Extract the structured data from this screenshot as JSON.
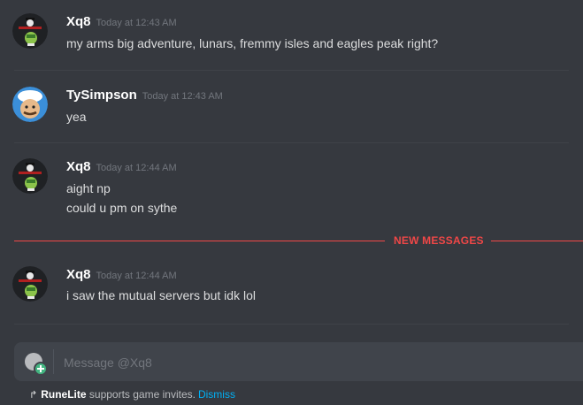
{
  "messages": [
    {
      "author": "Xq8",
      "time": "Today at 12:43 AM",
      "avatar": "pirate-skull-avatar",
      "lines": [
        "my arms big adventure, lunars, fremmy isles and eagles peak right?"
      ]
    },
    {
      "author": "TySimpson",
      "time": "Today at 12:43 AM",
      "avatar": "cartoon-chef-avatar",
      "lines": [
        "yea"
      ]
    },
    {
      "author": "Xq8",
      "time": "Today at 12:44 AM",
      "avatar": "pirate-skull-avatar",
      "lines": [
        "aight np",
        "could u pm on sythe"
      ]
    },
    {
      "author": "Xq8",
      "time": "Today at 12:44 AM",
      "avatar": "pirate-skull-avatar",
      "lines": [
        "i saw the mutual servers but idk lol"
      ]
    }
  ],
  "new_messages_label": "NEW MESSAGES",
  "composer": {
    "placeholder": "Message @Xq8",
    "value": ""
  },
  "invite_bar": {
    "arrow": "↱",
    "app_name": "RuneLite",
    "text": " supports game invites.",
    "dismiss_label": "Dismiss"
  },
  "colors": {
    "background": "#36393f",
    "new_messages": "#f04747",
    "link": "#00b0f4",
    "composer": "#40444b"
  }
}
